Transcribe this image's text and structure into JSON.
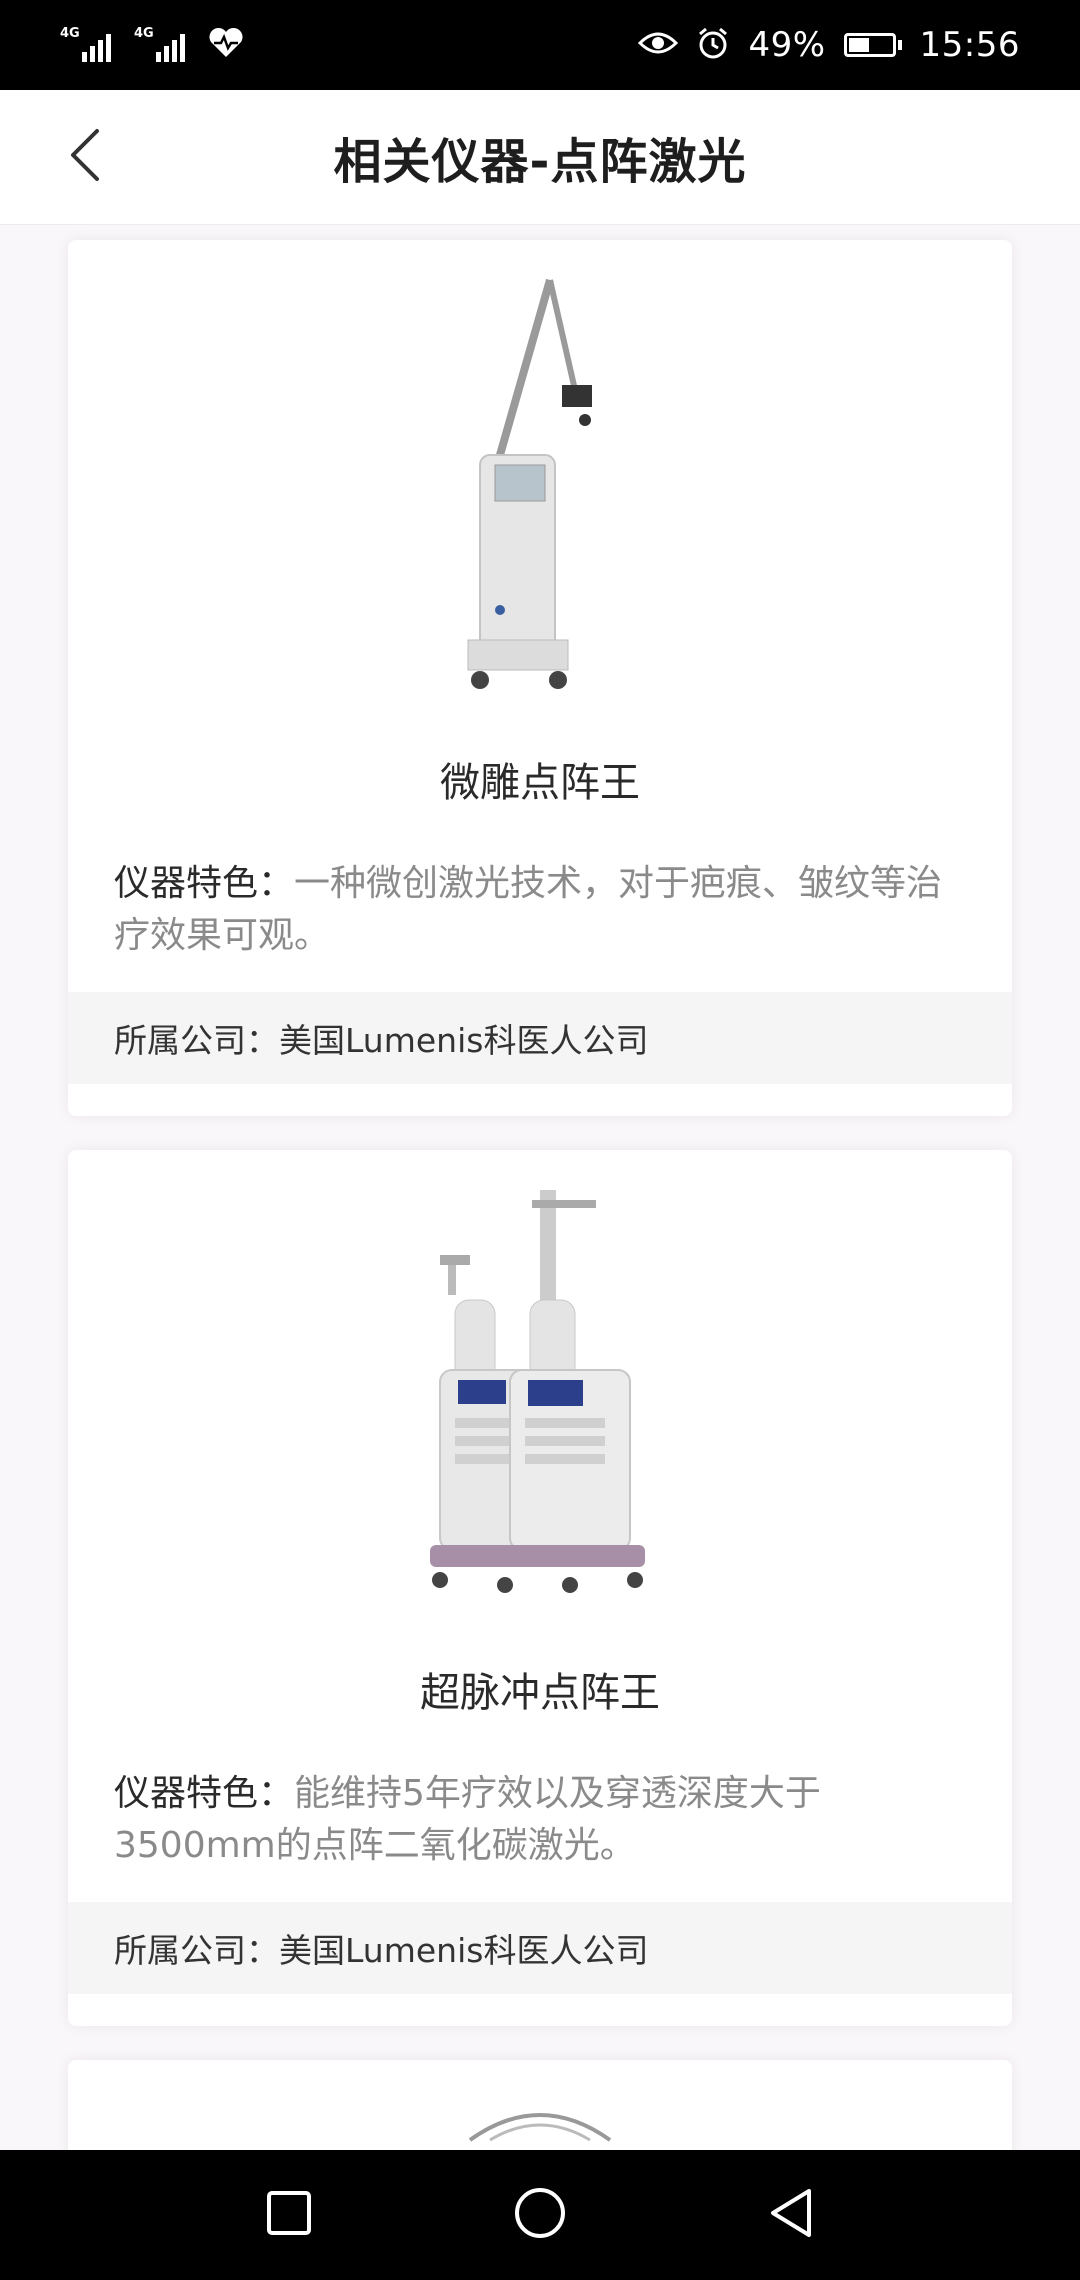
{
  "status_bar": {
    "network_1": "4G",
    "network_2": "4G",
    "battery_percent": "49%",
    "time": "15:56",
    "icons": [
      "signal-icon",
      "signal-icon",
      "heart-rate-icon",
      "eye-icon",
      "alarm-icon",
      "battery-icon"
    ]
  },
  "header": {
    "title": "相关仪器-点阵激光",
    "back_icon": "chevron-left-icon"
  },
  "instruments": [
    {
      "name": "微雕点阵王",
      "feature_label": "仪器特色：",
      "feature_text": "一种微创激光技术，对于疤痕、皱纹等治疗效果可观。",
      "company_label": "所属公司：",
      "company": "美国Lumenis科医人公司"
    },
    {
      "name": "超脉冲点阵王",
      "feature_label": "仪器特色：",
      "feature_text": "能维持5年疗效以及穿透深度大于3500mm的点阵二氧化碳激光。",
      "company_label": "所属公司：",
      "company": "美国Lumenis科医人公司"
    }
  ],
  "nav_bar": {
    "icons": [
      "recent-apps-icon",
      "home-icon",
      "back-icon"
    ]
  }
}
